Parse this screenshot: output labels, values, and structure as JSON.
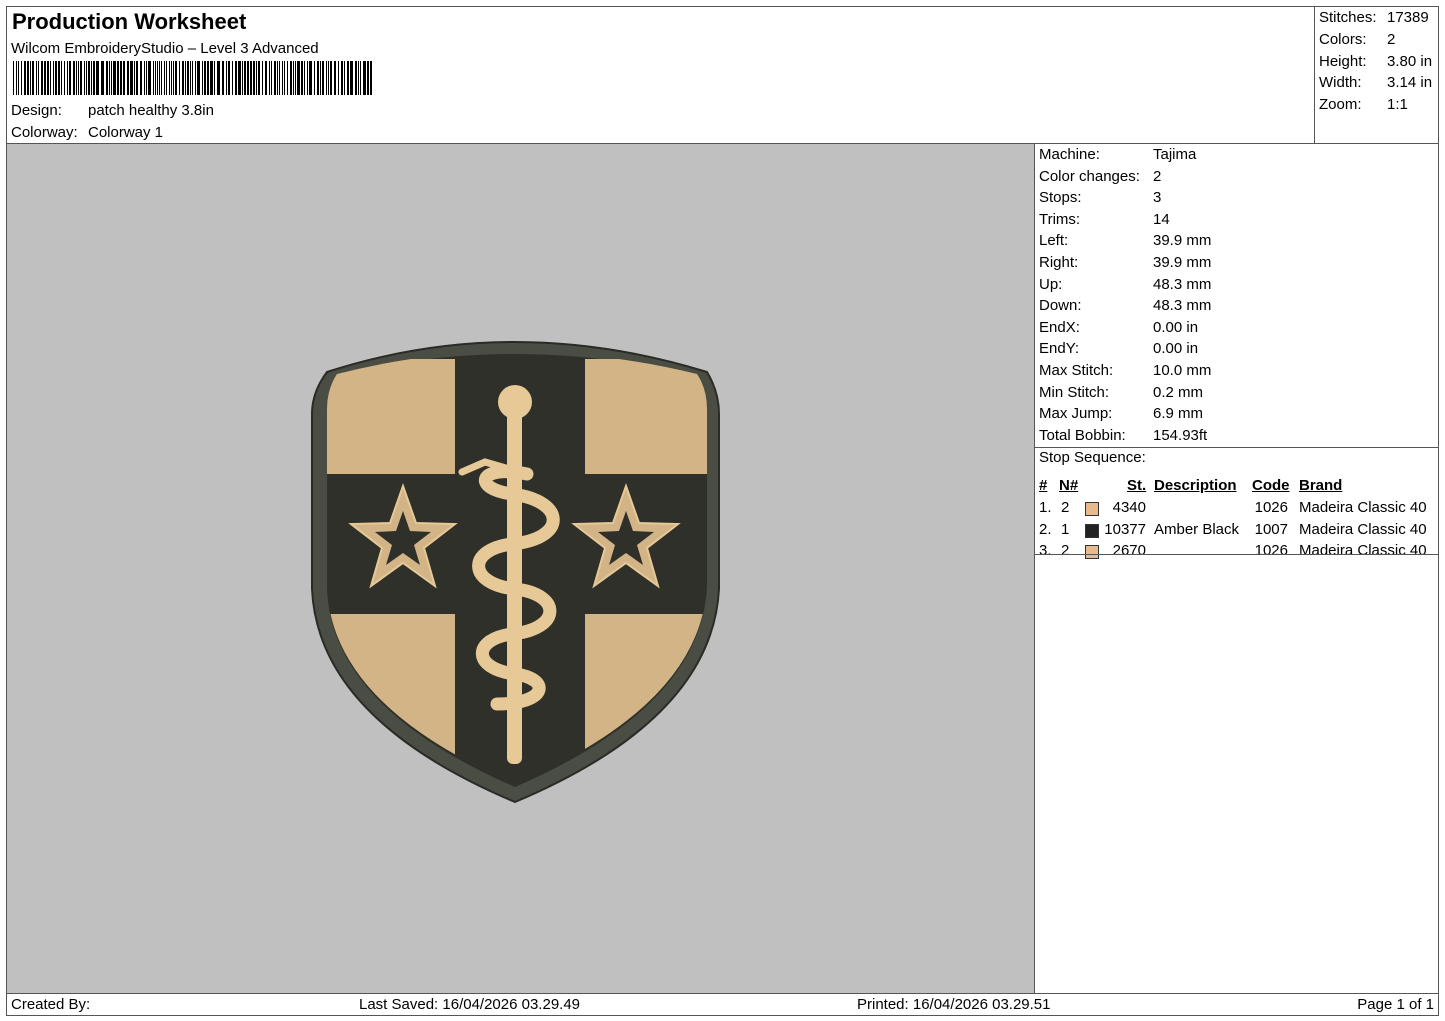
{
  "header": {
    "title": "Production Worksheet",
    "software": "Wilcom EmbroideryStudio – Level 3 Advanced",
    "design_label": "Design:",
    "design_value": "patch healthy 3.8in",
    "colorway_label": "Colorway:",
    "colorway_value": "Colorway 1"
  },
  "stats": [
    {
      "label": "Stitches:",
      "value": "17389"
    },
    {
      "label": "Colors:",
      "value": "2"
    },
    {
      "label": "Height:",
      "value": "3.80 in"
    },
    {
      "label": "Width:",
      "value": "3.14 in"
    },
    {
      "label": "Zoom:",
      "value": "1:1"
    }
  ],
  "machine": [
    {
      "label": "Machine:",
      "value": "Tajima"
    },
    {
      "label": "Color changes:",
      "value": "2"
    },
    {
      "label": "Stops:",
      "value": "3"
    },
    {
      "label": "Trims:",
      "value": "14"
    },
    {
      "label": "Left:",
      "value": "39.9 mm"
    },
    {
      "label": "Right:",
      "value": "39.9 mm"
    },
    {
      "label": "Up:",
      "value": "48.3 mm"
    },
    {
      "label": "Down:",
      "value": "48.3 mm"
    },
    {
      "label": "EndX:",
      "value": "0.00 in"
    },
    {
      "label": "EndY:",
      "value": "0.00 in"
    },
    {
      "label": "Max Stitch:",
      "value": "10.0 mm"
    },
    {
      "label": "Min Stitch:",
      "value": "0.2 mm"
    },
    {
      "label": "Max Jump:",
      "value": "6.9 mm"
    },
    {
      "label": "Total Bobbin:",
      "value": "154.93ft"
    }
  ],
  "stop_sequence": {
    "title": "Stop Sequence:",
    "headers": {
      "num": "#",
      "needle": "N#",
      "stitches": "St.",
      "description": "Description",
      "code": "Code",
      "brand": "Brand"
    },
    "rows": [
      {
        "num": "1.",
        "needle": "2",
        "color": "#e8b98c",
        "stitches": "4340",
        "description": "",
        "code": "1026",
        "brand": "Madeira Classic 40"
      },
      {
        "num": "2.",
        "needle": "1",
        "color": "#222222",
        "stitches": "10377",
        "description": "Amber Black",
        "code": "1007",
        "brand": "Madeira Classic 40"
      },
      {
        "num": "3.",
        "needle": "2",
        "color": "#e8b98c",
        "stitches": "2670",
        "description": "",
        "code": "1026",
        "brand": "Madeira Classic 40"
      }
    ]
  },
  "footer": {
    "created_by": "Created By:",
    "last_saved": "Last Saved: 16/04/2026 03.29.49",
    "printed": "Printed: 16/04/2026 03.29.51",
    "page": "Page 1 of 1"
  },
  "colors": {
    "preview_bg": "#c0c0c0",
    "patch_border": "#4a4d44",
    "patch_field": "#2f302a",
    "patch_tan": "#d2b487",
    "emblem_gold": "#e6c996"
  }
}
